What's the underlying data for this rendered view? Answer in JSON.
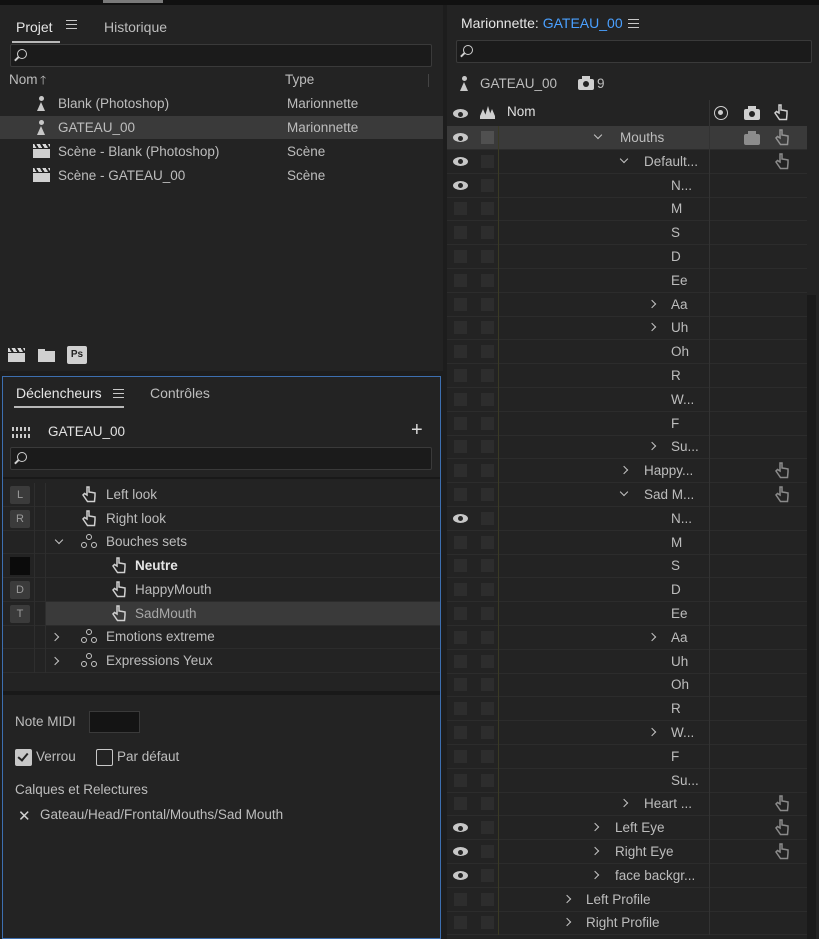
{
  "project": {
    "tabs": [
      "Projet",
      "Historique"
    ],
    "columns": {
      "name": "Nom",
      "type": "Type"
    },
    "sort_arrow": "🡑",
    "items": [
      {
        "name": "Blank (Photoshop)",
        "type": "Marionnette",
        "icon": "puppet-icon"
      },
      {
        "name": "GATEAU_00",
        "type": "Marionnette",
        "icon": "puppet-icon"
      },
      {
        "name": "Scène - Blank (Photoshop)",
        "type": "Scène",
        "icon": "scene-icon"
      },
      {
        "name": "Scène - GATEAU_00",
        "type": "Scène",
        "icon": "scene-icon"
      }
    ],
    "footer_ps": "Ps"
  },
  "triggers": {
    "tabs": [
      "Déclencheurs",
      "Contrôles"
    ],
    "puppet_name": "GATEAU_00",
    "add": "+",
    "rows": [
      {
        "key": "L",
        "label": "Left look"
      },
      {
        "key": "R",
        "label": "Right look"
      },
      {
        "key": "",
        "label": "Bouches sets"
      },
      {
        "key": "",
        "label": "Neutre"
      },
      {
        "key": "D",
        "label": "HappyMouth"
      },
      {
        "key": "T",
        "label": "SadMouth"
      },
      {
        "key": "",
        "label": "Emotions extreme"
      },
      {
        "key": "",
        "label": "Expressions Yeux"
      }
    ],
    "midi_label": "Note MIDI",
    "lock_label": "Verrou",
    "default_label": "Par défaut",
    "layers_label": "Calques et Relectures",
    "layer_path": "Gateau/Head/Frontal/Mouths/Sad Mouth",
    "remove_glyph": "✕"
  },
  "puppet": {
    "title_prefix": "Marionnette: ",
    "title_name": "GATEAU_00",
    "root_name": "GATEAU_00",
    "camera_count": "9",
    "col_name": "Nom",
    "accent": "#4aa0ff",
    "rows": [
      {
        "label": "Mouths"
      },
      {
        "label": "Default..."
      },
      {
        "label": "N..."
      },
      {
        "label": "M"
      },
      {
        "label": "S"
      },
      {
        "label": "D"
      },
      {
        "label": "Ee"
      },
      {
        "label": "Aa"
      },
      {
        "label": "Uh"
      },
      {
        "label": "Oh"
      },
      {
        "label": "R"
      },
      {
        "label": "W..."
      },
      {
        "label": "F"
      },
      {
        "label": "Su..."
      },
      {
        "label": "Happy..."
      },
      {
        "label": "Sad M..."
      },
      {
        "label": "N..."
      },
      {
        "label": "M"
      },
      {
        "label": "S"
      },
      {
        "label": "D"
      },
      {
        "label": "Ee"
      },
      {
        "label": "Aa"
      },
      {
        "label": "Uh"
      },
      {
        "label": "Oh"
      },
      {
        "label": "R"
      },
      {
        "label": "W..."
      },
      {
        "label": "F"
      },
      {
        "label": "Su..."
      },
      {
        "label": "Heart ..."
      },
      {
        "label": "Left Eye"
      },
      {
        "label": "Right Eye"
      },
      {
        "label": "face backgr..."
      },
      {
        "label": "Left Profile"
      },
      {
        "label": "Right Profile"
      }
    ]
  }
}
